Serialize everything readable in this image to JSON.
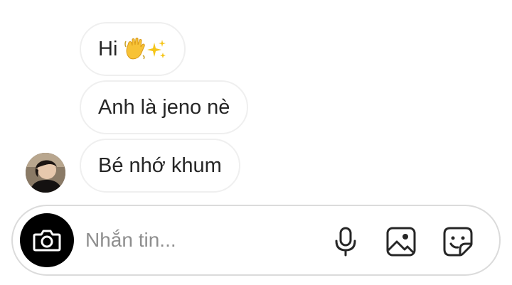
{
  "messages": [
    {
      "text": "Hi",
      "emoji": "👋✨"
    },
    {
      "text": "Anh là jeno nè"
    },
    {
      "text": "Bé nhớ khum"
    }
  ],
  "composer": {
    "placeholder": "Nhắn tin..."
  },
  "icons": {
    "camera": "camera-icon",
    "mic": "microphone-icon",
    "gallery": "image-icon",
    "sticker": "sticker-icon"
  },
  "colors": {
    "bubble_border": "#efefef",
    "composer_border": "#dbdbdb",
    "placeholder": "#8e8e8e",
    "camera_bg": "#000000"
  }
}
